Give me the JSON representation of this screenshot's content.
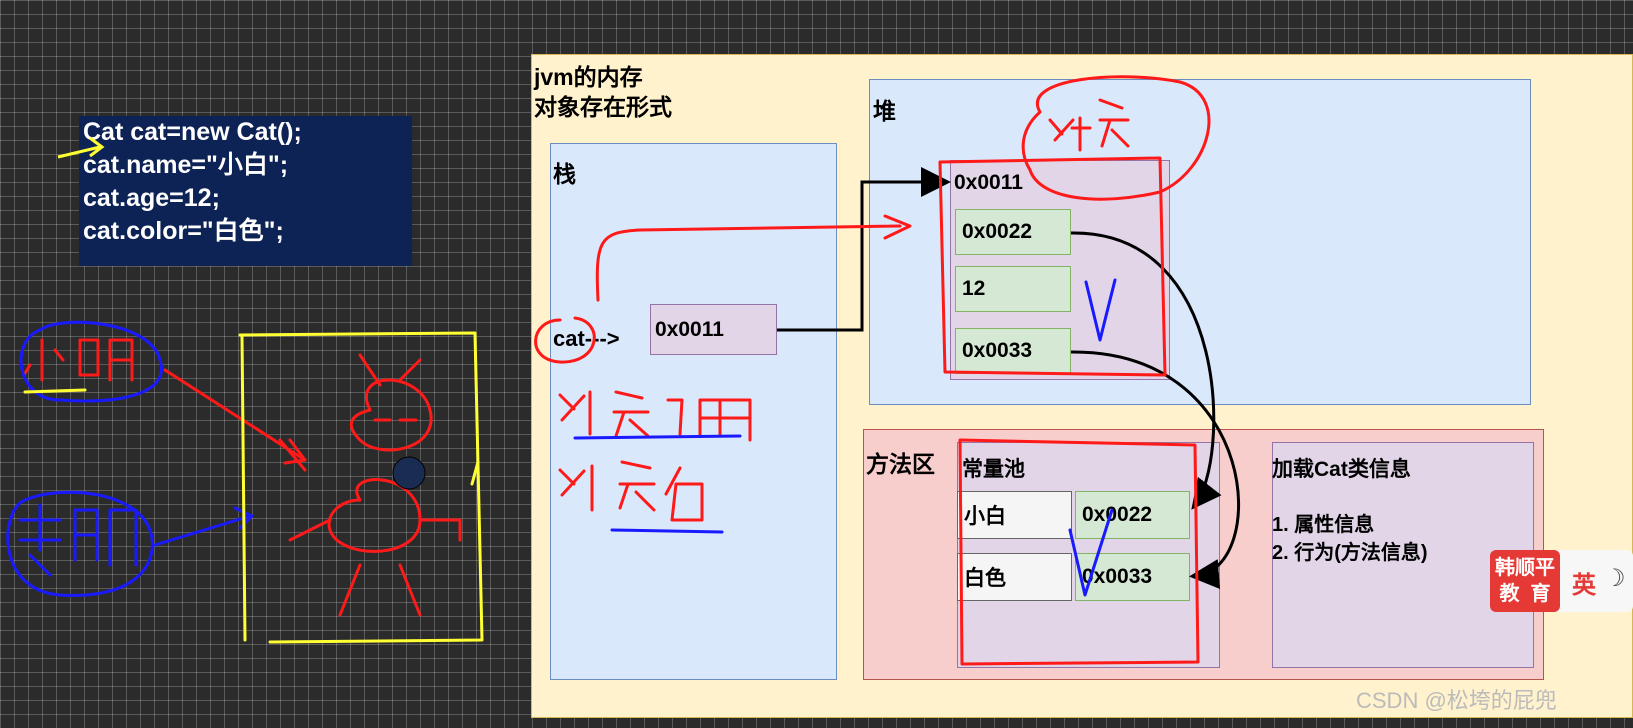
{
  "code": {
    "lines": [
      "Cat cat=new Cat();",
      "cat.name=\"小白\";",
      "cat.age=12;",
      "cat.color=\"白色\";"
    ]
  },
  "jvm": {
    "title_line1": "jvm的内存",
    "title_line2": "对象存在形式"
  },
  "stack": {
    "label": "栈",
    "var_label": "cat--->",
    "var_value": "0x0011"
  },
  "heap": {
    "label": "堆",
    "object_address": "0x0011",
    "fields": [
      "0x0022",
      "12",
      "0x0033"
    ]
  },
  "method_area": {
    "label": "方法区",
    "pool_label": "常量池",
    "pool_entries": [
      {
        "key": "小白",
        "value": "0x0022"
      },
      {
        "key": "白色",
        "value": "0x0033"
      }
    ],
    "class_info_title": "加载Cat类信息",
    "class_info_items": [
      "1. 属性信息",
      "2. 行为(方法信息)"
    ]
  },
  "badge": {
    "line1": "韩顺平",
    "line2": "教  育"
  },
  "ime": {
    "lang": "英"
  },
  "watermark": "CSDN @松垮的屁兜",
  "colors": {
    "background": "#2b2b2b",
    "code_bg": "#0d2356",
    "jvm_bg": "#fff2cc",
    "region_blue": "#dae8fc",
    "region_pink": "#f8cecc",
    "object_purple": "#e1d5e7",
    "field_green": "#d5e8d4",
    "annotation_red": "#ff1a1a",
    "annotation_blue": "#1a1aff",
    "annotation_yellow": "#ffff33"
  }
}
